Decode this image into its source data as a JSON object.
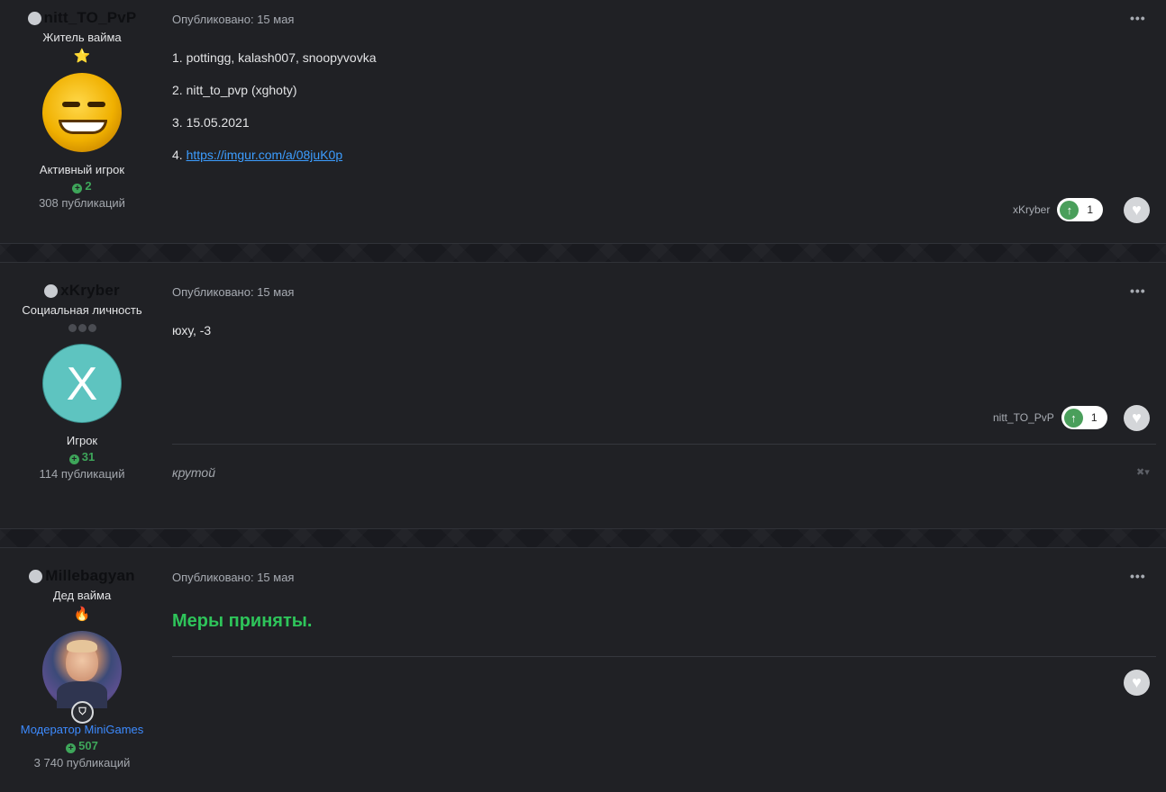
{
  "posts": [
    {
      "author": "nitt_TO_PvP",
      "title": "Житель вайма",
      "rank_icon": "star-icon",
      "avatar": "smiley-avatar",
      "group": "Активный игрок",
      "reputation": "2",
      "posts_count": "308 публикаций",
      "date": "Опубликовано: 15 мая",
      "body": [
        "1. pottingg, kalash007, snoopyvovka",
        "2. nitt_to_pvp (xghoty)",
        "3. 15.05.2021"
      ],
      "link_prefix": "4. ",
      "link_text": "https://imgur.com/a/08juK0p",
      "reacted_by": "xKryber",
      "reaction_count": "1"
    },
    {
      "author": "xKryber",
      "title": "Социальная личность",
      "rank_icon": "dots-icon",
      "avatar_letter": "X",
      "group": "Игрок",
      "reputation": "31",
      "posts_count": "114 публикаций",
      "date": "Опубликовано: 15 мая",
      "body": [
        "юху, -3"
      ],
      "reacted_by": "nitt_TO_PvP",
      "reaction_count": "1",
      "comment": "крутой"
    },
    {
      "author": "Millebagyan",
      "title": "Дед вайма",
      "rank_icon": "fire-icon",
      "avatar": "photo-avatar",
      "group": "Модератор MiniGames",
      "reputation": "507",
      "posts_count": "3 740 публикаций",
      "date": "Опубликовано: 15 мая",
      "body_title": "Меры приняты."
    }
  ],
  "colors": {
    "background": "#202125",
    "reputation": "#3ea65a",
    "link": "#3c9dff",
    "moderator": "#3d8bff",
    "highlight": "#2ec45a"
  }
}
